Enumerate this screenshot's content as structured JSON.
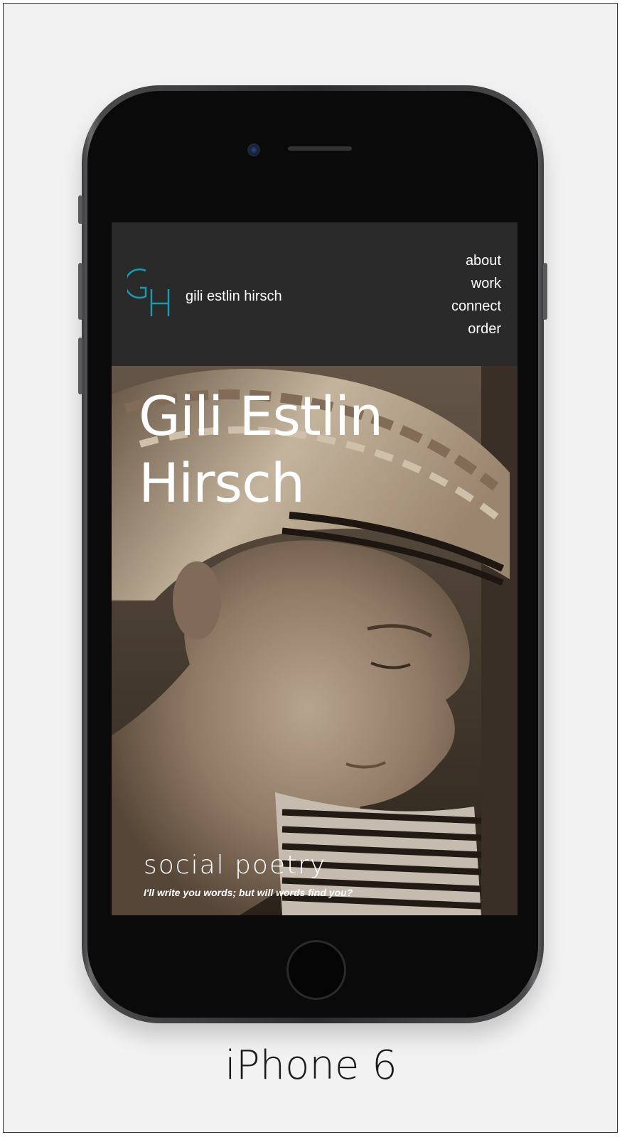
{
  "site": {
    "logo_monogram": "GH",
    "name": "gili estlin hirsch",
    "nav": [
      {
        "label": "about"
      },
      {
        "label": "work"
      },
      {
        "label": "connect"
      },
      {
        "label": "order"
      }
    ],
    "accent_color": "#1b9bb0",
    "header_bg": "#2a2a2a"
  },
  "hero": {
    "title": "Gili Estlin Hirsch",
    "tagline": "social poetry",
    "subtitle": "I'll write you words; but will words find you?",
    "image": "sepia-portrait-woman-braided-hair-headband"
  },
  "device": {
    "caption": "iPhone 6"
  }
}
